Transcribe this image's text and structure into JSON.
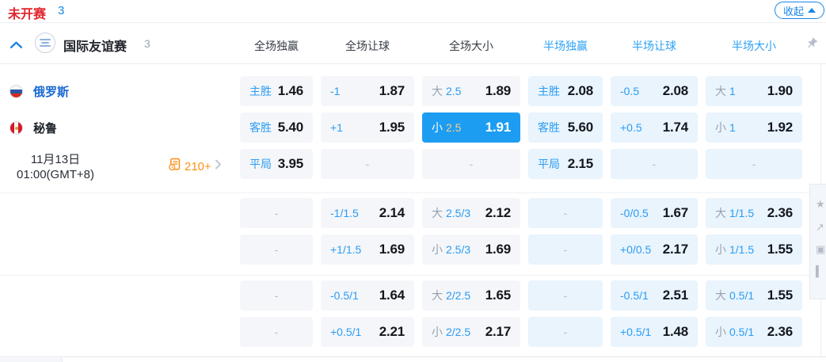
{
  "top_bar": {
    "status_label": "未开赛",
    "status_count": "3",
    "collapse_label": "收起"
  },
  "group_header": {
    "league_name": "国际友谊赛",
    "match_count": "3",
    "columns": [
      "全场独赢",
      "全场让球",
      "全场大小",
      "半场独赢",
      "半场让球",
      "半场大小"
    ]
  },
  "match": {
    "home_team": "俄罗斯",
    "away_team": "秘鲁",
    "date": "11月13日",
    "time": "01:00(GMT+8)",
    "more_markets_count": "210+"
  },
  "odds": {
    "dash_label": "-",
    "rows": [
      {
        "cells": [
          {
            "label": "主胜",
            "value": "1.46"
          },
          {
            "label": "-1",
            "value": "1.87"
          },
          {
            "side": "大",
            "line": "2.5",
            "value": "1.89"
          },
          {
            "label": "主胜",
            "value": "2.08"
          },
          {
            "label": "-0.5",
            "value": "2.08"
          },
          {
            "side": "大",
            "line": "1",
            "value": "1.90"
          }
        ]
      },
      {
        "cells": [
          {
            "label": "客胜",
            "value": "5.40"
          },
          {
            "label": "+1",
            "value": "1.95"
          },
          {
            "side": "小",
            "line": "2.5",
            "value": "1.91",
            "selected": true
          },
          {
            "label": "客胜",
            "value": "5.60"
          },
          {
            "label": "+0.5",
            "value": "1.74"
          },
          {
            "side": "小",
            "line": "1",
            "value": "1.92"
          }
        ]
      },
      {
        "cells": [
          {
            "label": "平局",
            "value": "3.95"
          },
          {},
          {},
          {
            "label": "平局",
            "value": "2.15"
          },
          {},
          {}
        ]
      },
      {
        "cells": [
          {},
          {
            "label": "-1/1.5",
            "value": "2.14"
          },
          {
            "side": "大",
            "line": "2.5/3",
            "value": "2.12"
          },
          {},
          {
            "label": "-0/0.5",
            "value": "1.67"
          },
          {
            "side": "大",
            "line": "1/1.5",
            "value": "2.36"
          }
        ]
      },
      {
        "cells": [
          {},
          {
            "label": "+1/1.5",
            "value": "1.69"
          },
          {
            "side": "小",
            "line": "2.5/3",
            "value": "1.69"
          },
          {},
          {
            "label": "+0/0.5",
            "value": "2.17"
          },
          {
            "side": "小",
            "line": "1/1.5",
            "value": "1.55"
          }
        ]
      },
      {
        "cells": [
          {},
          {
            "label": "-0.5/1",
            "value": "1.64"
          },
          {
            "side": "大",
            "line": "2/2.5",
            "value": "1.65"
          },
          {},
          {
            "label": "-0.5/1",
            "value": "2.51"
          },
          {
            "side": "大",
            "line": "0.5/1",
            "value": "1.55"
          }
        ]
      },
      {
        "cells": [
          {},
          {
            "label": "+0.5/1",
            "value": "2.21"
          },
          {
            "side": "小",
            "line": "2/2.5",
            "value": "2.17"
          },
          {},
          {
            "label": "+0.5/1",
            "value": "1.48"
          },
          {
            "side": "小",
            "line": "0.5/1",
            "value": "2.36"
          }
        ]
      }
    ]
  },
  "icons": {
    "rail_icons": [
      "★",
      "↗",
      "▣",
      "▍"
    ]
  },
  "colors": {
    "accent_blue": "#1d9df2",
    "header_blue": "#2ba0f6",
    "status_red": "#e1252c",
    "markets_orange": "#ff9015",
    "selected_bg": "#1d9df2",
    "selected_line_text": "#f3cd8f",
    "fulltime_cell_bg": "#f4f6f9",
    "halftime_cell_bg": "#e9f4fd"
  }
}
